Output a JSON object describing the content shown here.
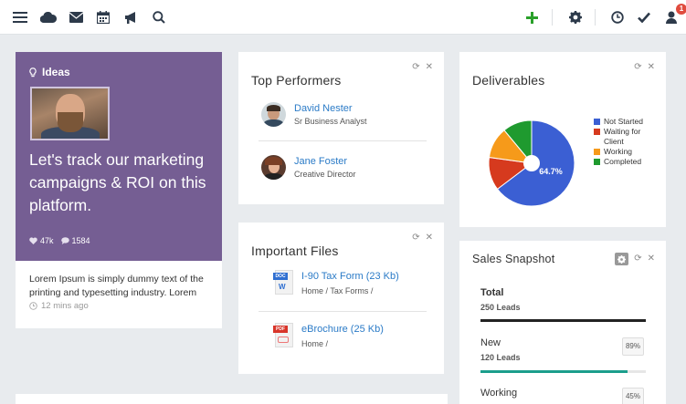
{
  "topbar": {
    "left_icons": [
      "menu-icon",
      "cloud-icon",
      "mail-icon",
      "calendar-icon",
      "megaphone-icon",
      "search-icon"
    ],
    "right_icons": [
      "add-icon",
      "gear-icon",
      "clock-icon",
      "check-icon",
      "user-icon"
    ],
    "notification_count": "1"
  },
  "ideas": {
    "heading": "Ideas",
    "quote": "Let's track our marketing campaigns & ROI on this platform.",
    "likes": "47k",
    "comments": "1584",
    "body": "Lorem Ipsum is simply dummy text of the printing and typesetting industry. Lorem",
    "time": "12 mins ago"
  },
  "performers": {
    "title": "Top Performers",
    "people": [
      {
        "name": "David Nester",
        "role": "Sr Business Analyst"
      },
      {
        "name": "Jane Foster",
        "role": "Creative Director"
      }
    ]
  },
  "files": {
    "title": "Important Files",
    "items": [
      {
        "name": "I-90 Tax Form (23 Kb)",
        "path": "Home / Tax Forms /",
        "type": "DOC"
      },
      {
        "name": "eBrochure (25 Kb)",
        "path": "Home /",
        "type": "PDF"
      }
    ]
  },
  "deliverables": {
    "title": "Deliverables",
    "chart_data": {
      "type": "pie",
      "categories": [
        "Not Started",
        "Waiting for Client",
        "Working",
        "Completed"
      ],
      "values": [
        64.7,
        12.5,
        11.8,
        11.0
      ],
      "colors": [
        "#3b5fd3",
        "#d63a1e",
        "#f69a1a",
        "#1f9a2f"
      ],
      "annotations": [
        "64.7%"
      ],
      "legend": "right"
    }
  },
  "sales": {
    "title": "Sales Snapshot",
    "rows": [
      {
        "label": "Total",
        "leads": "250 Leads",
        "percent": "",
        "fill": 1.0,
        "color": "#222222"
      },
      {
        "label": "New",
        "leads": "120 Leads",
        "percent": "89%",
        "fill": 0.89,
        "color": "#1b9e8c"
      },
      {
        "label": "Working",
        "leads": "",
        "percent": "45%",
        "fill": 0.45,
        "color": "#1b9e8c"
      }
    ]
  }
}
